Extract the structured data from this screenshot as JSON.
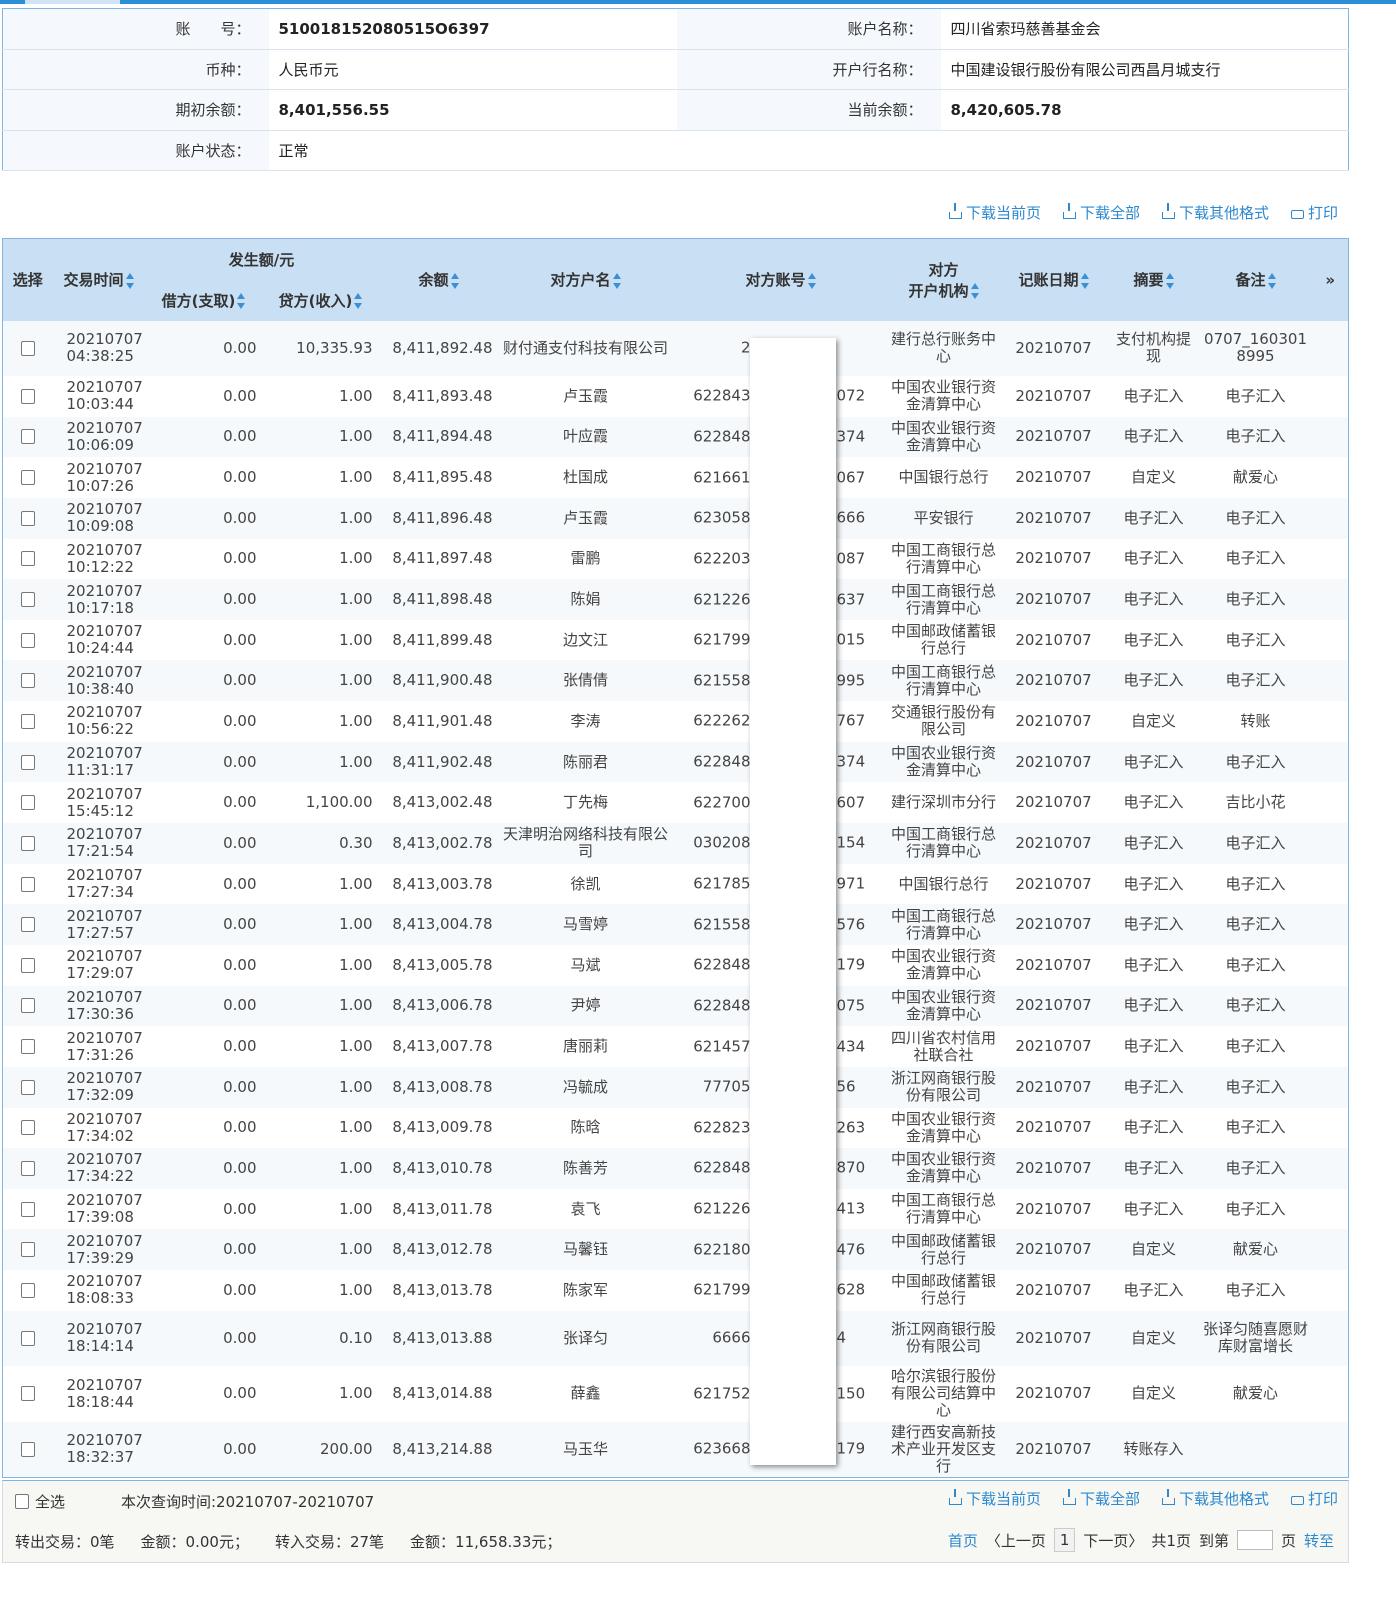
{
  "account_info": {
    "account_no_label": "账　　号：",
    "account_no": "510018152080515O6397",
    "account_name_label": "账户名称：",
    "account_name": "四川省索玛慈善基金会",
    "currency_label": "币种：",
    "currency": "人民币元",
    "bank_label": "开户行名称：",
    "bank": "中国建设银行股份有限公司西昌月城支行",
    "opening_balance_label": "期初余额：",
    "opening_balance": "8,401,556.55",
    "current_balance_label": "当前余额：",
    "current_balance": "8,420,605.78",
    "status_label": "账户状态：",
    "status": "正常"
  },
  "actions": {
    "download_page": "下载当前页",
    "download_all": "下载全部",
    "download_other": "下载其他格式",
    "print": "打印"
  },
  "table": {
    "headers": {
      "select": "选择",
      "time": "交易时间",
      "amount_group": "发生额/元",
      "debit": "借方(支取)",
      "credit": "贷方(收入)",
      "balance": "余额",
      "counterparty_name": "对方户名",
      "counterparty_account": "对方账号",
      "institution_1": "对方",
      "institution_2": "开户机构",
      "posting_date": "记账日期",
      "summary": "摘要",
      "remark": "备注",
      "more": "»"
    },
    "rows": [
      {
        "date": "20210707",
        "time": "04:38:25",
        "debit": "0.00",
        "credit": "10,335.93",
        "balance": "8,411,892.48",
        "name": "财付通支付科技有限公司",
        "acct_prefix": "2",
        "acct_suffix": "",
        "inst": "建行总行账务中心",
        "post": "20210707",
        "summary": "支付机构提现",
        "remark": "0707_1603018995"
      },
      {
        "date": "20210707",
        "time": "10:03:44",
        "debit": "0.00",
        "credit": "1.00",
        "balance": "8,411,893.48",
        "name": "卢玉霞",
        "acct_prefix": "622843",
        "acct_suffix": "072",
        "inst": "中国农业银行资金清算中心",
        "post": "20210707",
        "summary": "电子汇入",
        "remark": "电子汇入"
      },
      {
        "date": "20210707",
        "time": "10:06:09",
        "debit": "0.00",
        "credit": "1.00",
        "balance": "8,411,894.48",
        "name": "叶应霞",
        "acct_prefix": "622848",
        "acct_suffix": "374",
        "inst": "中国农业银行资金清算中心",
        "post": "20210707",
        "summary": "电子汇入",
        "remark": "电子汇入"
      },
      {
        "date": "20210707",
        "time": "10:07:26",
        "debit": "0.00",
        "credit": "1.00",
        "balance": "8,411,895.48",
        "name": "杜国成",
        "acct_prefix": "621661",
        "acct_suffix": "067",
        "inst": "中国银行总行",
        "post": "20210707",
        "summary": "自定义",
        "remark": "献爱心"
      },
      {
        "date": "20210707",
        "time": "10:09:08",
        "debit": "0.00",
        "credit": "1.00",
        "balance": "8,411,896.48",
        "name": "卢玉霞",
        "acct_prefix": "623058",
        "acct_suffix": "666",
        "inst": "平安银行",
        "post": "20210707",
        "summary": "电子汇入",
        "remark": "电子汇入"
      },
      {
        "date": "20210707",
        "time": "10:12:22",
        "debit": "0.00",
        "credit": "1.00",
        "balance": "8,411,897.48",
        "name": "雷鹏",
        "acct_prefix": "622203",
        "acct_suffix": "087",
        "inst": "中国工商银行总行清算中心",
        "post": "20210707",
        "summary": "电子汇入",
        "remark": "电子汇入"
      },
      {
        "date": "20210707",
        "time": "10:17:18",
        "debit": "0.00",
        "credit": "1.00",
        "balance": "8,411,898.48",
        "name": "陈娟",
        "acct_prefix": "621226",
        "acct_suffix": "637",
        "inst": "中国工商银行总行清算中心",
        "post": "20210707",
        "summary": "电子汇入",
        "remark": "电子汇入"
      },
      {
        "date": "20210707",
        "time": "10:24:44",
        "debit": "0.00",
        "credit": "1.00",
        "balance": "8,411,899.48",
        "name": "边文江",
        "acct_prefix": "621799",
        "acct_suffix": "015",
        "inst": "中国邮政储蓄银行总行",
        "post": "20210707",
        "summary": "电子汇入",
        "remark": "电子汇入"
      },
      {
        "date": "20210707",
        "time": "10:38:40",
        "debit": "0.00",
        "credit": "1.00",
        "balance": "8,411,900.48",
        "name": "张倩倩",
        "acct_prefix": "621558",
        "acct_suffix": "995",
        "inst": "中国工商银行总行清算中心",
        "post": "20210707",
        "summary": "电子汇入",
        "remark": "电子汇入"
      },
      {
        "date": "20210707",
        "time": "10:56:22",
        "debit": "0.00",
        "credit": "1.00",
        "balance": "8,411,901.48",
        "name": "李涛",
        "acct_prefix": "622262",
        "acct_suffix": "767",
        "inst": "交通银行股份有限公司",
        "post": "20210707",
        "summary": "自定义",
        "remark": "转账"
      },
      {
        "date": "20210707",
        "time": "11:31:17",
        "debit": "0.00",
        "credit": "1.00",
        "balance": "8,411,902.48",
        "name": "陈丽君",
        "acct_prefix": "622848",
        "acct_suffix": "374",
        "inst": "中国农业银行资金清算中心",
        "post": "20210707",
        "summary": "电子汇入",
        "remark": "电子汇入"
      },
      {
        "date": "20210707",
        "time": "15:45:12",
        "debit": "0.00",
        "credit": "1,100.00",
        "balance": "8,413,002.48",
        "name": "丁先梅",
        "acct_prefix": "622700",
        "acct_suffix": "607",
        "inst": "建行深圳市分行",
        "post": "20210707",
        "summary": "电子汇入",
        "remark": "吉比小花"
      },
      {
        "date": "20210707",
        "time": "17:21:54",
        "debit": "0.00",
        "credit": "0.30",
        "balance": "8,413,002.78",
        "name": "天津明治网络科技有限公司",
        "acct_prefix": "030208",
        "acct_suffix": "154",
        "inst": "中国工商银行总行清算中心",
        "post": "20210707",
        "summary": "电子汇入",
        "remark": "电子汇入"
      },
      {
        "date": "20210707",
        "time": "17:27:34",
        "debit": "0.00",
        "credit": "1.00",
        "balance": "8,413,003.78",
        "name": "徐凯",
        "acct_prefix": "621785",
        "acct_suffix": "971",
        "inst": "中国银行总行",
        "post": "20210707",
        "summary": "电子汇入",
        "remark": "电子汇入"
      },
      {
        "date": "20210707",
        "time": "17:27:57",
        "debit": "0.00",
        "credit": "1.00",
        "balance": "8,413,004.78",
        "name": "马雪婷",
        "acct_prefix": "621558",
        "acct_suffix": "576",
        "inst": "中国工商银行总行清算中心",
        "post": "20210707",
        "summary": "电子汇入",
        "remark": "电子汇入"
      },
      {
        "date": "20210707",
        "time": "17:29:07",
        "debit": "0.00",
        "credit": "1.00",
        "balance": "8,413,005.78",
        "name": "马斌",
        "acct_prefix": "622848",
        "acct_suffix": "179",
        "inst": "中国农业银行资金清算中心",
        "post": "20210707",
        "summary": "电子汇入",
        "remark": "电子汇入"
      },
      {
        "date": "20210707",
        "time": "17:30:36",
        "debit": "0.00",
        "credit": "1.00",
        "balance": "8,413,006.78",
        "name": "尹婷",
        "acct_prefix": "622848",
        "acct_suffix": "075",
        "inst": "中国农业银行资金清算中心",
        "post": "20210707",
        "summary": "电子汇入",
        "remark": "电子汇入"
      },
      {
        "date": "20210707",
        "time": "17:31:26",
        "debit": "0.00",
        "credit": "1.00",
        "balance": "8,413,007.78",
        "name": "唐丽莉",
        "acct_prefix": "621457",
        "acct_suffix": "434",
        "inst": "四川省农村信用社联合社",
        "post": "20210707",
        "summary": "电子汇入",
        "remark": "电子汇入"
      },
      {
        "date": "20210707",
        "time": "17:32:09",
        "debit": "0.00",
        "credit": "1.00",
        "balance": "8,413,008.78",
        "name": "冯毓成",
        "acct_prefix": "77705",
        "acct_suffix": "56",
        "inst": "浙江网商银行股份有限公司",
        "post": "20210707",
        "summary": "电子汇入",
        "remark": "电子汇入"
      },
      {
        "date": "20210707",
        "time": "17:34:02",
        "debit": "0.00",
        "credit": "1.00",
        "balance": "8,413,009.78",
        "name": "陈晗",
        "acct_prefix": "622823",
        "acct_suffix": "263",
        "inst": "中国农业银行资金清算中心",
        "post": "20210707",
        "summary": "电子汇入",
        "remark": "电子汇入"
      },
      {
        "date": "20210707",
        "time": "17:34:22",
        "debit": "0.00",
        "credit": "1.00",
        "balance": "8,413,010.78",
        "name": "陈善芳",
        "acct_prefix": "622848",
        "acct_suffix": "870",
        "inst": "中国农业银行资金清算中心",
        "post": "20210707",
        "summary": "电子汇入",
        "remark": "电子汇入"
      },
      {
        "date": "20210707",
        "time": "17:39:08",
        "debit": "0.00",
        "credit": "1.00",
        "balance": "8,413,011.78",
        "name": "袁飞",
        "acct_prefix": "621226",
        "acct_suffix": "413",
        "inst": "中国工商银行总行清算中心",
        "post": "20210707",
        "summary": "电子汇入",
        "remark": "电子汇入"
      },
      {
        "date": "20210707",
        "time": "17:39:29",
        "debit": "0.00",
        "credit": "1.00",
        "balance": "8,413,012.78",
        "name": "马馨钰",
        "acct_prefix": "622180",
        "acct_suffix": "476",
        "inst": "中国邮政储蓄银行总行",
        "post": "20210707",
        "summary": "自定义",
        "remark": "献爱心"
      },
      {
        "date": "20210707",
        "time": "18:08:33",
        "debit": "0.00",
        "credit": "1.00",
        "balance": "8,413,013.78",
        "name": "陈家军",
        "acct_prefix": "621799",
        "acct_suffix": "628",
        "inst": "中国邮政储蓄银行总行",
        "post": "20210707",
        "summary": "电子汇入",
        "remark": "电子汇入"
      },
      {
        "date": "20210707",
        "time": "18:14:14",
        "debit": "0.00",
        "credit": "0.10",
        "balance": "8,413,013.88",
        "name": "张译匀",
        "acct_prefix": "6666",
        "acct_suffix": "4",
        "inst": "浙江网商银行股份有限公司",
        "post": "20210707",
        "summary": "自定义",
        "remark": "张译匀随喜愿财库财富增长"
      },
      {
        "date": "20210707",
        "time": "18:18:44",
        "debit": "0.00",
        "credit": "1.00",
        "balance": "8,413,014.88",
        "name": "薛鑫",
        "acct_prefix": "621752",
        "acct_suffix": "150",
        "inst": "哈尔滨银行股份有限公司结算中心",
        "post": "20210707",
        "summary": "自定义",
        "remark": "献爱心"
      },
      {
        "date": "20210707",
        "time": "18:32:37",
        "debit": "0.00",
        "credit": "200.00",
        "balance": "8,413,214.88",
        "name": "马玉华",
        "acct_prefix": "623668",
        "acct_suffix": "179",
        "inst": "建行西安高新技术产业开发区支行",
        "post": "20210707",
        "summary": "转账存入",
        "remark": ""
      }
    ]
  },
  "footer": {
    "select_all": "全选",
    "query_time": "本次查询时间:20210707-20210707",
    "out_tx": "转出交易：0笔",
    "out_amount": "金额：0.00元；",
    "in_tx": "转入交易：27笔",
    "in_amount": "金额：11,658.33元；",
    "pager": {
      "first": "首页",
      "prev": "〈上一页",
      "current": "1",
      "next": "下一页〉",
      "total": "共1页",
      "goto_prefix": "到第",
      "goto_suffix": "页",
      "go": "转至"
    }
  }
}
